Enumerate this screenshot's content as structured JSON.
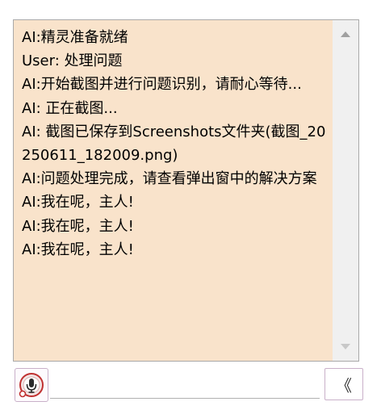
{
  "chat": {
    "messages": [
      "AI:精灵准备就绪",
      "User: 处理问题",
      "AI:开始截图并进行问题识别，请耐心等待...",
      "AI: 正在截图...",
      "AI: 截图已保存到Screenshots文件夹(截图_20250611_182009.png)",
      "AI:问题处理完成，请查看弹出窗中的解决方案",
      "AI:我在呢，主人!",
      "AI:我在呢，主人!",
      "AI:我在呢，主人!"
    ],
    "background_color": "#f9e3cb"
  },
  "input": {
    "value": "",
    "placeholder": ""
  },
  "icons": {
    "mic": "microphone-icon",
    "scroll_up": "scroll-up-arrow-icon",
    "scroll_down": "scroll-down-arrow-icon"
  },
  "collapse_button": {
    "label": "《"
  }
}
